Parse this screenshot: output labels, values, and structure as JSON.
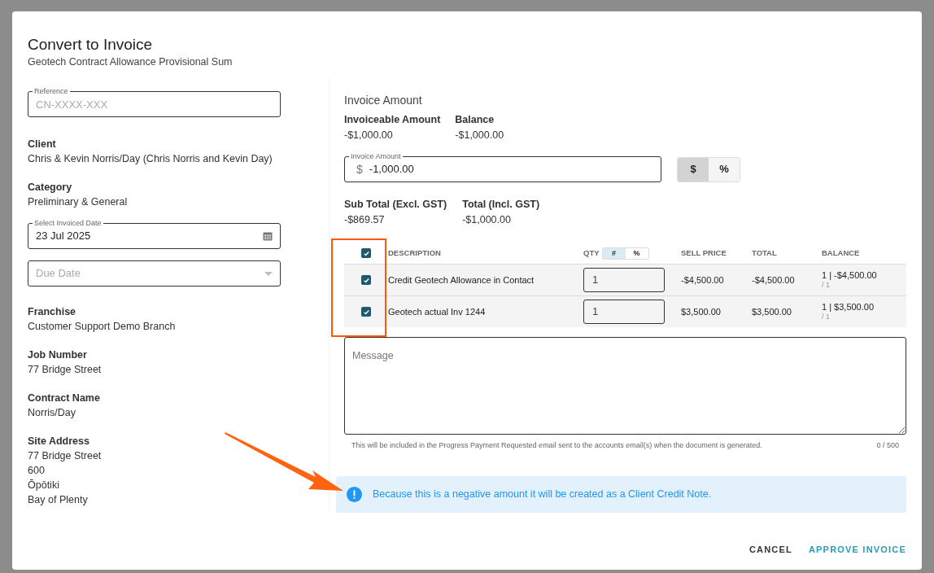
{
  "dialog": {
    "title": "Convert to Invoice",
    "subtitle": "Geotech Contract Allowance Provisional Sum"
  },
  "left_fields": [
    {
      "kind": "input",
      "label": "Reference",
      "placeholder": "CN-XXXX-XXX"
    },
    {
      "kind": "info",
      "label": "Client",
      "lines": [
        "Chris & Kevin Norris/Day (Chris Norris and Kevin Day)"
      ]
    },
    {
      "kind": "info",
      "label": "Category",
      "lines": [
        "Preliminary & General"
      ]
    },
    {
      "kind": "date",
      "label": "Select Invoiced Date",
      "value": "23 Jul 2025"
    },
    {
      "kind": "select",
      "placeholder": "Due Date"
    },
    {
      "kind": "info",
      "label": "Franchise",
      "lines": [
        "Customer Support Demo Branch"
      ]
    },
    {
      "kind": "info",
      "label": "Job Number",
      "lines": [
        "77 Bridge Street"
      ]
    },
    {
      "kind": "info",
      "label": "Contract Name",
      "lines": [
        "Norris/Day"
      ]
    },
    {
      "kind": "info",
      "label": "Site Address",
      "lines": [
        "77 Bridge Street",
        "600",
        "Ōpōtiki",
        "Bay of Plenty"
      ]
    }
  ],
  "invoice": {
    "heading": "Invoice Amount",
    "summary": [
      {
        "label": "Invoiceable Amount",
        "value": "-$1,000.00"
      },
      {
        "label": "Balance",
        "value": "-$1,000.00"
      }
    ],
    "amount_field": {
      "label": "Invoice Amount",
      "prefix": "$",
      "value": "-1,000.00"
    },
    "mode_toggle": [
      {
        "label": "$",
        "selected": true
      },
      {
        "label": "%",
        "selected": false
      }
    ],
    "totals": [
      {
        "label": "Sub Total (Excl. GST)",
        "value": "-$869.57"
      },
      {
        "label": "Total (Incl. GST)",
        "value": "-$1,000.00"
      }
    ]
  },
  "table": {
    "select_all_checked": true,
    "columns": [
      "DESCRIPTION",
      "QTY",
      "SELL PRICE",
      "TOTAL",
      "BALANCE"
    ],
    "qty_toggle": [
      {
        "label": "#",
        "selected": true
      },
      {
        "label": "%",
        "selected": false
      }
    ],
    "rows": [
      {
        "checked": true,
        "description": "Credit Geotech Allowance in Contact",
        "qty": "1",
        "sell_price": "-$4,500.00",
        "total": "-$4,500.00",
        "balance": "1 | -$4,500.00",
        "balance_sub": "/ 1"
      },
      {
        "checked": true,
        "description": "Geotech actual Inv 1244",
        "qty": "1",
        "sell_price": "$3,500.00",
        "total": "$3,500.00",
        "balance": "1 | $3,500.00",
        "balance_sub": "/ 1"
      }
    ]
  },
  "message": {
    "placeholder": "Message",
    "helper": "This will be included in the Progress Payment Requested email sent to the accounts email(s) when the document is generated.",
    "counter": "0 / 500"
  },
  "alert": {
    "text": "Because this is a negative amount it will be created as a Client Credit Note."
  },
  "buttons": [
    {
      "label": "CANCEL",
      "kind": "secondary"
    },
    {
      "label": "APPROVE INVOICE",
      "kind": "primary"
    }
  ]
}
